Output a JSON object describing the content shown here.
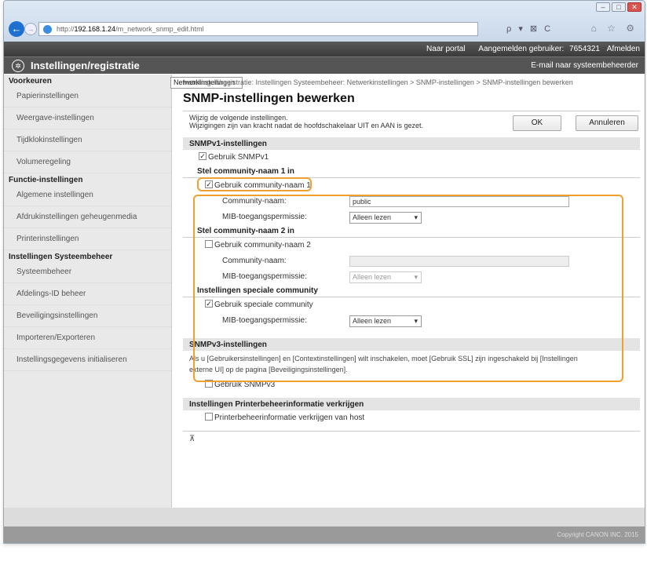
{
  "browser": {
    "url_prefix": "http://",
    "url_host": "192.168.1.24",
    "url_path": "/m_network_snmp_edit.html",
    "tools": "ρ ▾ ⊠ C",
    "tools2": "⌂ ☆ ⚙"
  },
  "topbar": {
    "portal": "Naar portal",
    "login_label": "Aangemelden gebruiker:",
    "login_user": "7654321",
    "logout": "Afmelden"
  },
  "header": {
    "title": "Instellingen/registratie",
    "mail": "E-mail naar systeembeheerder"
  },
  "sidebar": {
    "section1": "Voorkeuren",
    "items1": [
      "Papierinstellingen",
      "Weergave-instellingen",
      "Tijdklokinstellingen",
      "Volumeregeling"
    ],
    "section2": "Functie-instellingen",
    "items2": [
      "Algemene instellingen",
      "Afdrukinstellingen geheugenmedia",
      "Printerinstellingen"
    ],
    "section3": "Instellingen Systeembeheer",
    "items3": [
      "Systeembeheer",
      "Afdelings-ID beheer",
      "Netwerkinstellingen",
      "Beveiligingsinstellingen",
      "Importeren/Exporteren",
      "Instellingsgegevens initialiseren"
    ]
  },
  "main": {
    "breadcrumb": "Instellingen/registratie: Instellingen Systeembeheer: Netwerkinstellingen > SNMP-instellingen > SNMP-instellingen bewerken",
    "title": "SNMP-instellingen bewerken",
    "desc1": "Wijzig de volgende instellingen.",
    "desc2": "Wijzigingen zijn van kracht nadat de hoofdschakelaar UIT en AAN is gezet.",
    "ok": "OK",
    "cancel": "Annuleren",
    "v1_header": "SNMPv1-instellingen",
    "use_v1": "Gebruik SNMPv1",
    "c1_header": "Stel community-naam 1 in",
    "use_c1": "Gebruik community-naam 1",
    "community_label": "Community-naam:",
    "mib_label": "MIB-toegangspermissie:",
    "c1_value": "public",
    "mib_value": "Alleen lezen",
    "c2_header": "Stel community-naam 2 in",
    "use_c2": "Gebruik community-naam 2",
    "special_header": "Instellingen speciale community",
    "use_special": "Gebruik speciale community",
    "v3_header": "SNMPv3-instellingen",
    "v3_note1": "Als u [Gebruikersinstellingen] en [Contextinstellingen] wilt inschakelen, moet [Gebruik SSL] zijn ingeschakeld bij [Instellingen",
    "v3_note2": "externe UI] op de pagina [Beveiligingsinstellingen].",
    "use_v3": "Gebruik SNMPv3",
    "printer_header": "Instellingen Printerbeheerinformatie verkrijgen",
    "printer_item": "Printerbeheerinformatie verkrijgen van host",
    "top_link": "⊼"
  },
  "footer": {
    "copyright": "Copyright CANON INC. 2015"
  }
}
